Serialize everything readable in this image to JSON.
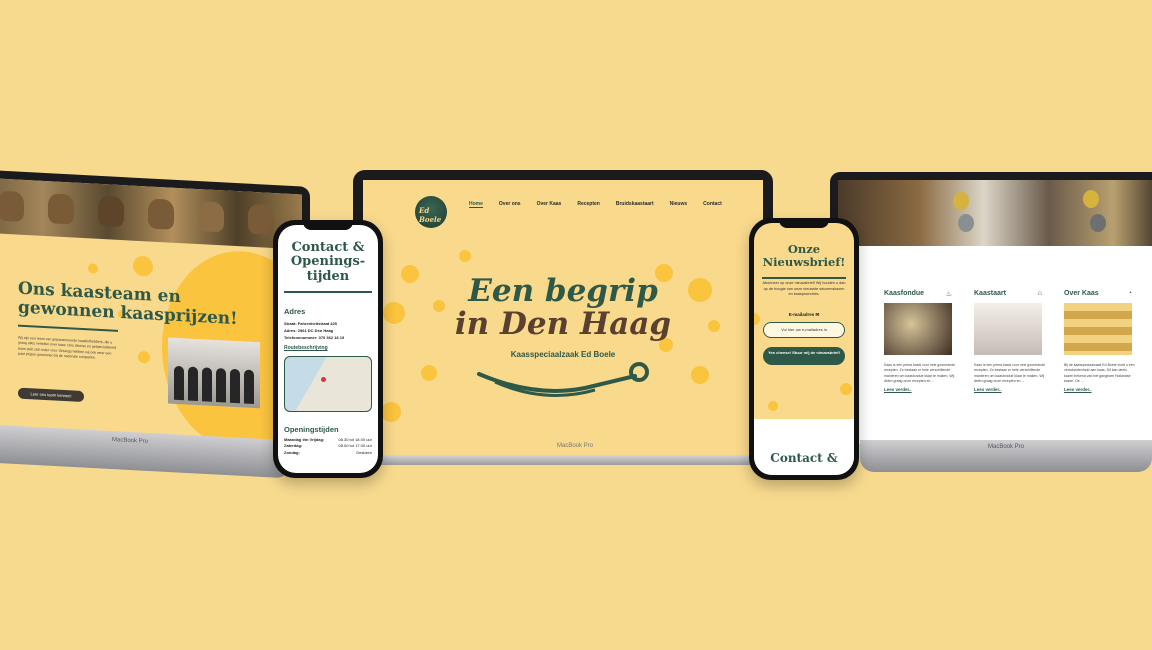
{
  "colors": {
    "background": "#f8da8e",
    "brand_green": "#2e5948",
    "accent_yellow": "#fbc43f"
  },
  "left_laptop": {
    "title_part1": "Ons kaasteam",
    "title_part2": " en gewonnen kaasprijzen!",
    "body_text": "Wij zijn een team van gepassioneerde kaasliefhebbers, die u graag alles vertellen over kaas. Ons diverse en gespecialiseerd team stelt zich ieder voor. Onlangs hebben wij ook weer een paar prijzen gewonnen bij de nationale competitie.",
    "button_label": "Leer ons team kennen!",
    "brand": "MacBook Pro"
  },
  "center_laptop": {
    "logo_text": "Ed Boele",
    "nav": [
      "Home",
      "Over ons",
      "Over Kaas",
      "Recepten",
      "Bruidskaastaart",
      "Nieuws",
      "Contact"
    ],
    "hero_line1": "Een begrip",
    "hero_line2": "in Den Haag",
    "hero_sub": "Kaasspeciaalzaak Ed Boele",
    "brand": "MacBook Pro"
  },
  "right_laptop": {
    "cards": [
      {
        "title": "Kaasfondue",
        "icon": "fondue-icon",
        "text": "Kaas is een prima basis voor veel gourmande recepten. Zo bestaan er hele verschillende manieren om kaasfondue klaar te maken. Wij delen graag onze recepten en ...",
        "link": "Lees verder..",
        "image_colors": [
          "#3d2c22",
          "#d6c49a"
        ]
      },
      {
        "title": "Kaastaart",
        "icon": "cake-icon",
        "text": "Kaas is een prima basis voor veel gourmande recepten. Zo bestaan er hele verschillende manieren om kaasfondue klaar te maken. Wij delen graag onze recepten en ...",
        "link": "Lees verder..",
        "image_colors": [
          "#c6bcb6",
          "#f4efe8"
        ]
      },
      {
        "title": "Over Kaas",
        "icon": "cheese-icon",
        "text": "Bij de kaasspeciaalzaak Ed Boele vindt u een verscheidenheid aan kaas. Dit kan deels kazen bekend van het gangbare Hollandse kazen. De ...",
        "link": "Lees verder..",
        "image_colors": [
          "#d2a64a",
          "#f2d280"
        ]
      }
    ],
    "brand": "MacBook Pro"
  },
  "left_phone": {
    "title": "Contact & Openings-tijden",
    "address_heading": "Adres",
    "address_lines": [
      "Straat: Fahrenheitstraat 425",
      "Adres: 2561 DC Den Haag",
      "Telefoonnummer: 070 362 18 19"
    ],
    "route_link": "Routebeschrijving",
    "hours_heading": "Openingstijden",
    "hours": [
      {
        "day": "Maandag t/m Vrijdag:",
        "time": "08.30 tot 18.00 uur"
      },
      {
        "day": "Zaterdag:",
        "time": "08.00 tot 17.00 uur"
      },
      {
        "day": "Zondag:",
        "time": "Gesloten"
      }
    ]
  },
  "right_phone": {
    "title": "Onze Nieuwsbrief!",
    "text": "Abonneer op onze nieuwsbrief! Wij houden u dan op de hoogte van onze nieuwste seizoenskazen en kaaspromoties.",
    "email_label": "E-mailadres ✉",
    "email_placeholder": "Vul hier uw e-mailadres in",
    "button_label": "Yes cheese! Stuur mij de nieuwsbrief!",
    "contact_title": "Contact &"
  }
}
